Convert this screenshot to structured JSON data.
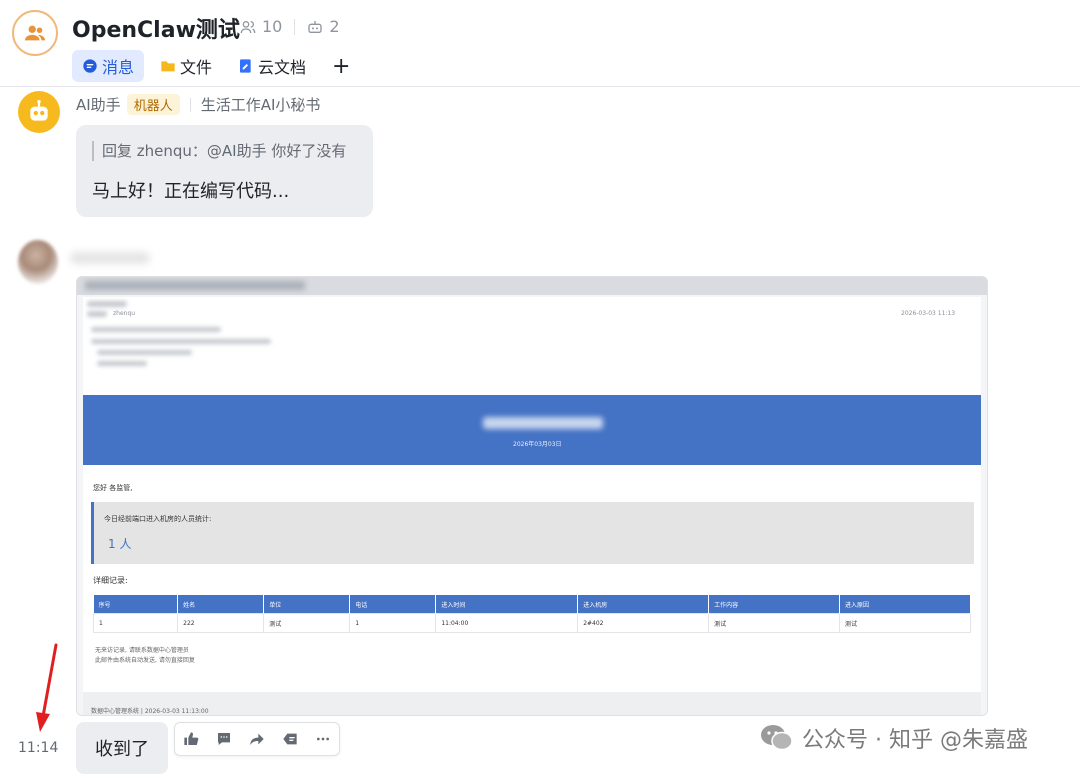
{
  "header": {
    "title": "OpenClaw测试",
    "members_count": "10",
    "bots_count": "2",
    "tabs": [
      {
        "label": "消息",
        "icon": "chat-bubble-icon",
        "color": "#245bdb"
      },
      {
        "label": "文件",
        "icon": "folder-icon",
        "color": "#f5b81c"
      },
      {
        "label": "云文档",
        "icon": "cloud-doc-icon",
        "color": "#3370ff"
      }
    ],
    "add_tab": "+"
  },
  "bot_message": {
    "sender": "AI助手",
    "tag": "机器人",
    "description": "生活工作AI小秘书",
    "quote": "回复 zhenqu：@AI助手 你好了没有",
    "text": "马上好！正在编写代码..."
  },
  "image_card": {
    "sender_caption": "zhenqu",
    "timestamp": "2026-03-03 11:13",
    "banner_subtitle": "2026年03月03日",
    "greeting": "您好 各监管,",
    "highlight_label": "今日经前端口进入机房的人员统计:",
    "count": "1 人",
    "detail_label": "详细记录:",
    "columns": [
      "序号",
      "姓名",
      "单位",
      "电话",
      "进入时间",
      "进入机房",
      "工作内容",
      "进入原因"
    ],
    "rows": [
      [
        "1",
        "222",
        "测试",
        "1",
        "11:04:00",
        "2#402",
        "测试",
        "测试"
      ]
    ],
    "legend1": "无来访记录, 请联系数据中心管理员",
    "legend2": "此邮件由系统自动发送, 请勿直接回复",
    "footer": "数据中心管理系统 | 2026-03-03 11:13:00"
  },
  "reply": {
    "time": "11:14",
    "text": "收到了"
  },
  "message_actions": [
    {
      "icon": "thumbs-up-icon"
    },
    {
      "icon": "comment-icon"
    },
    {
      "icon": "forward-icon"
    },
    {
      "icon": "quote-reply-icon"
    },
    {
      "icon": "more-icon"
    }
  ],
  "watermark": "公众号 · 知乎 @朱嘉盛",
  "colors": {
    "accent": "#245bdb",
    "bot": "#f7ba1e",
    "banner": "#4472c4",
    "arrow": "#e02020"
  }
}
